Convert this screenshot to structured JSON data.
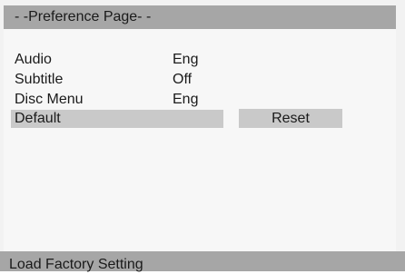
{
  "header": {
    "title": "- -Preference Page- -"
  },
  "menu": {
    "items": [
      {
        "label": "Audio",
        "value": "Eng"
      },
      {
        "label": "Subtitle",
        "value": "Off"
      },
      {
        "label": "Disc Menu",
        "value": "Eng"
      },
      {
        "label": "Default",
        "value": ""
      }
    ],
    "selected": "Default"
  },
  "submenu": {
    "reset_label": "Reset"
  },
  "status": {
    "text": "Load Factory Setting"
  },
  "colors": {
    "bar": "#a6a6a6",
    "highlight": "#c9c9c9",
    "background": "#f7f7f7"
  }
}
